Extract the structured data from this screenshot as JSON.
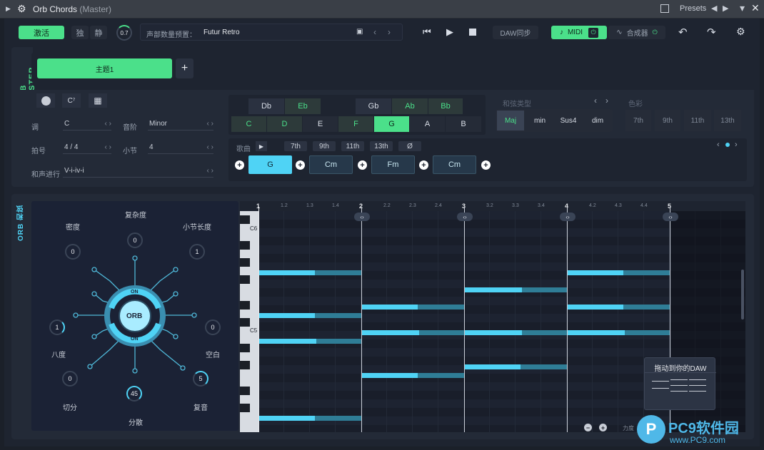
{
  "app": {
    "title": "Orb Chords",
    "subtitle": "(Master)",
    "presets_label": "Presets"
  },
  "topbar": {
    "activate": "激活",
    "solo": "独",
    "mute": "静",
    "knob_value": "0.7",
    "voice_label": "声部数量预置：",
    "voice_value": "Futur Retro",
    "daw_sync": "DAW同步",
    "midi": "MIDI",
    "synth": "合成器"
  },
  "master": {
    "vertical_label": "ORB MASTER",
    "theme_tab": "主题1",
    "add": "+"
  },
  "params": {
    "key_label": "调",
    "key_value": "C",
    "scale_label": "音阶",
    "scale_value": "Minor",
    "beat_label": "拍号",
    "beat_value": "4 / 4",
    "bar_label": "小节",
    "bar_value": "4",
    "prog_label": "和声进行",
    "prog_value": "V-i-iv-i"
  },
  "keys": {
    "black": [
      "Db",
      "Eb",
      "Gb",
      "Ab",
      "Bb"
    ],
    "white": [
      "C",
      "D",
      "E",
      "F",
      "G",
      "A",
      "B"
    ]
  },
  "chord_type": {
    "label": "和弦类型",
    "items": [
      "Maj",
      "min",
      "Sus4",
      "dim"
    ]
  },
  "color": {
    "label": "色彩",
    "items": [
      "7th",
      "9th",
      "11th",
      "13th"
    ]
  },
  "song": {
    "label": "歌曲",
    "exts": [
      "7th",
      "9th",
      "11th",
      "13th",
      "Ø"
    ],
    "chords": [
      "G",
      "Cm",
      "Fm",
      "Cm"
    ]
  },
  "orb": {
    "vertical_label": "ORB 和弦",
    "on_top": "ON",
    "on_bottom": "ON",
    "center": "ORB",
    "density_label": "密度",
    "density": "0",
    "complexity_label": "复杂度",
    "complexity": "0",
    "barlen_label": "小节长度",
    "barlen": "1",
    "octave_label": "八度",
    "octave": "1",
    "space_label": "空白",
    "space": "0",
    "cut_label": "切分",
    "cut": "0",
    "disperse_label": "分散",
    "disperse": "45",
    "repeat_label": "复音",
    "repeat": "5"
  },
  "roll": {
    "bars": [
      "1",
      "2",
      "3",
      "4",
      "5"
    ],
    "subs": [
      "1.2",
      "1.3",
      "1.4",
      "2.2",
      "2.3",
      "2.4",
      "3.2",
      "3.3",
      "3.4",
      "4.2",
      "4.3",
      "4.4"
    ],
    "c6": "C6",
    "c5": "C5",
    "drag_label": "拖动到你的DAW",
    "velocity_label": "力度"
  },
  "colors": {
    "accent": "#4be08a",
    "note": "#4fd3f5",
    "selected_chord": "#4fd3f5"
  },
  "watermark": {
    "brand": "PC9软件园",
    "url": "www.PC9.com"
  }
}
